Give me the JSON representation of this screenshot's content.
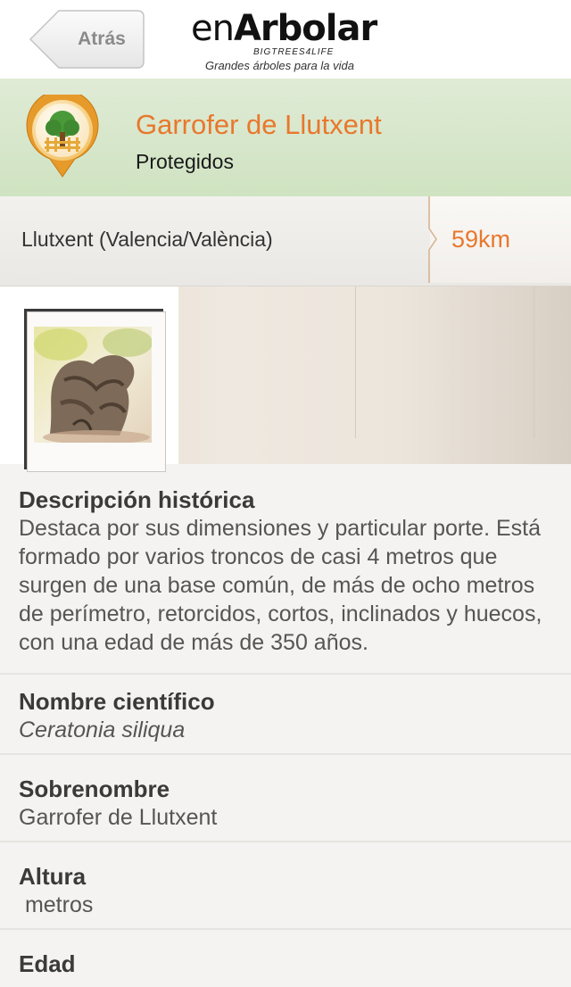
{
  "nav": {
    "back_label": "Atrás",
    "brand_en": "en",
    "brand_arbolar": "Arbolar",
    "brand_sub": "BIGTREES4LIFE",
    "brand_tagline": "Grandes árboles para la vida"
  },
  "tree": {
    "name": "Garrofer de Llutxent",
    "category": "Protegidos",
    "location": "Llutxent (Valencia/València)",
    "distance": "59km"
  },
  "sections": {
    "history_title": "Descripción histórica",
    "history_body": "Destaca por sus dimensiones y particular porte. Está formado por varios troncos de casi 4 metros que surgen de una base común, de más de ocho metros de perímetro, retorcidos, cortos, inclinados y huecos, con una edad de más de 350 años.",
    "scientific_title": "Nombre científico",
    "scientific_value": "Ceratonia siliqua",
    "nickname_title": "Sobrenombre",
    "nickname_value": "Garrofer de Llutxent",
    "height_title": "Altura",
    "height_value": " metros",
    "age_title": "Edad"
  },
  "colors": {
    "accent": "#e8782d",
    "header_green": "#d7e7cb"
  }
}
